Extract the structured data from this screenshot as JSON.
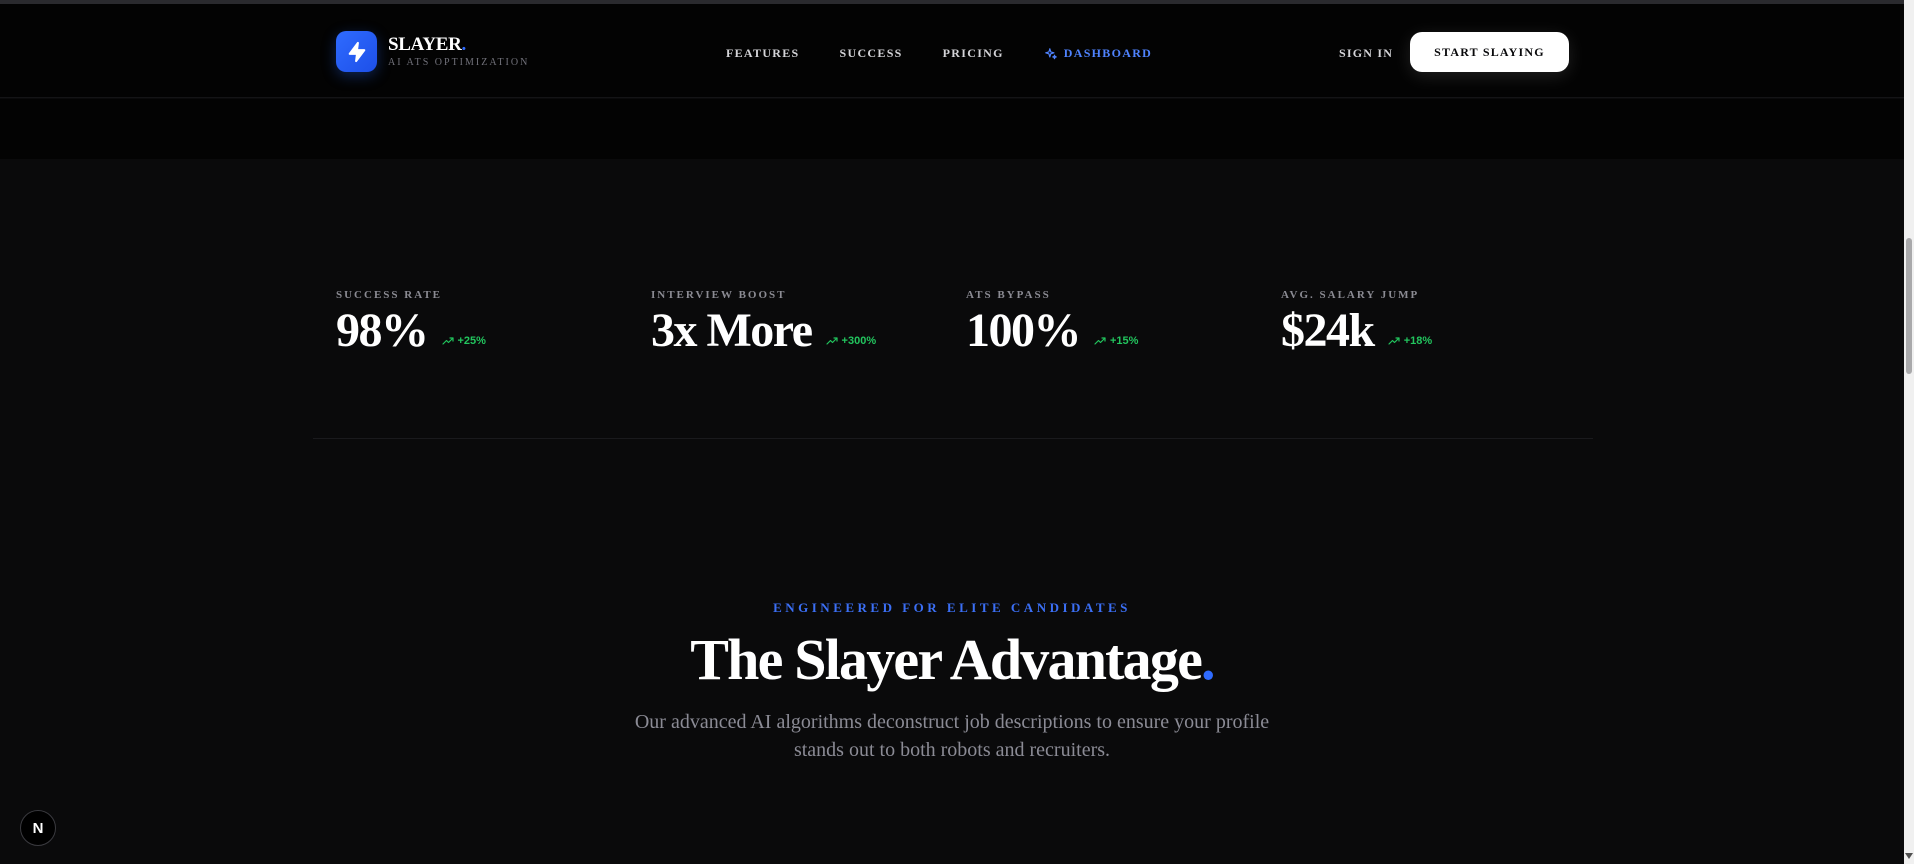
{
  "brand": {
    "name": "SLAYER",
    "dot": ".",
    "tagline": "AI ATS OPTIMIZATION",
    "icon": "lightning-bolt-icon"
  },
  "nav": {
    "items": [
      {
        "label": "FEATURES"
      },
      {
        "label": "SUCCESS"
      },
      {
        "label": "PRICING"
      },
      {
        "label": "DASHBOARD",
        "icon": "sparkles-icon",
        "active": true
      }
    ],
    "signin_label": "SIGN IN",
    "cta_label": "START SLAYING"
  },
  "stats": [
    {
      "label": "SUCCESS RATE",
      "value": "98%",
      "delta": "+25%"
    },
    {
      "label": "INTERVIEW BOOST",
      "value": "3x More",
      "delta": "+300%"
    },
    {
      "label": "ATS BYPASS",
      "value": "100%",
      "delta": "+15%"
    },
    {
      "label": "AVG. SALARY JUMP",
      "value": "$24k",
      "delta": "+18%"
    }
  ],
  "advantage": {
    "eyebrow": "ENGINEERED FOR ELITE CANDIDATES",
    "title": "The Slayer Advantage",
    "title_dot": ".",
    "description": "Our advanced AI algorithms deconstruct job descriptions to ensure your profile stands out to both robots and recruiters."
  },
  "dev_badge": {
    "label": "N"
  },
  "colors": {
    "accent": "#2f6bff",
    "positive": "#22c55e",
    "background": "#0a0a0b",
    "header": "#030303"
  }
}
